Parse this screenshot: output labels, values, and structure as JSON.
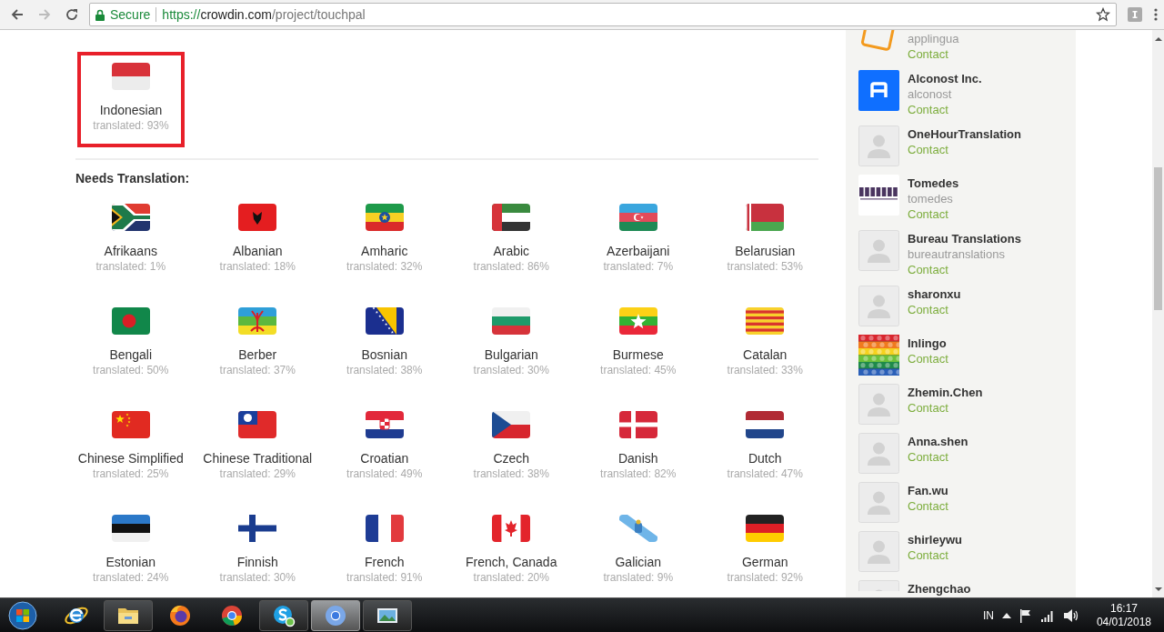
{
  "browser": {
    "secure_label": "Secure",
    "url": {
      "scheme": "https://",
      "host": "crowdin.com",
      "path": "/project/touchpal"
    }
  },
  "preferred": [
    {
      "name": "Indonesian",
      "progress": "translated: 93%",
      "selected": true
    }
  ],
  "needs_translation": {
    "title": "Needs Translation:",
    "languages": [
      {
        "name": "Afrikaans",
        "progress": "translated: 1%"
      },
      {
        "name": "Albanian",
        "progress": "translated: 18%"
      },
      {
        "name": "Amharic",
        "progress": "translated: 32%"
      },
      {
        "name": "Arabic",
        "progress": "translated: 86%"
      },
      {
        "name": "Azerbaijani",
        "progress": "translated: 7%"
      },
      {
        "name": "Belarusian",
        "progress": "translated: 53%"
      },
      {
        "name": "Bengali",
        "progress": "translated: 50%"
      },
      {
        "name": "Berber",
        "progress": "translated: 37%"
      },
      {
        "name": "Bosnian",
        "progress": "translated: 38%"
      },
      {
        "name": "Bulgarian",
        "progress": "translated: 30%"
      },
      {
        "name": "Burmese",
        "progress": "translated: 45%"
      },
      {
        "name": "Catalan",
        "progress": "translated: 33%"
      },
      {
        "name": "Chinese Simplified",
        "progress": "translated: 25%"
      },
      {
        "name": "Chinese Traditional",
        "progress": "translated: 29%"
      },
      {
        "name": "Croatian",
        "progress": "translated: 49%"
      },
      {
        "name": "Czech",
        "progress": "translated: 38%"
      },
      {
        "name": "Danish",
        "progress": "translated: 82%"
      },
      {
        "name": "Dutch",
        "progress": "translated: 47%"
      },
      {
        "name": "Estonian",
        "progress": "translated: 24%"
      },
      {
        "name": "Finnish",
        "progress": "translated: 30%"
      },
      {
        "name": "French",
        "progress": "translated: 91%"
      },
      {
        "name": "French, Canada",
        "progress": "translated: 20%"
      },
      {
        "name": "Galician",
        "progress": "translated: 9%"
      },
      {
        "name": "German",
        "progress": "translated: 92%"
      }
    ]
  },
  "vendors": [
    {
      "kind": "orange-logo",
      "handle": "applingua",
      "contact": "Contact"
    },
    {
      "kind": "blue-logo",
      "name": "Alconost Inc.",
      "handle": "alconost",
      "contact": "Contact"
    },
    {
      "kind": "placeholder",
      "name": "OneHourTranslation",
      "contact": "Contact"
    },
    {
      "kind": "wordmark-logo",
      "name": "Tomedes",
      "handle": "tomedes",
      "contact": "Contact"
    },
    {
      "kind": "placeholder",
      "name": "Bureau Translations",
      "handle": "bureautranslations",
      "contact": "Contact"
    },
    {
      "kind": "placeholder",
      "name": "sharonxu",
      "contact": "Contact"
    },
    {
      "kind": "picture",
      "name": "Inlingo",
      "contact": "Contact"
    },
    {
      "kind": "placeholder",
      "name": "Zhemin.Chen",
      "contact": "Contact"
    },
    {
      "kind": "placeholder",
      "name": "Anna.shen",
      "contact": "Contact"
    },
    {
      "kind": "placeholder",
      "name": "Fan.wu",
      "contact": "Contact"
    },
    {
      "kind": "placeholder",
      "name": "shirleywu",
      "contact": "Contact"
    },
    {
      "kind": "placeholder",
      "name": "Zhengchao"
    }
  ],
  "taskbar": {
    "apps": [
      {
        "kind": "ie",
        "open": false,
        "active": false
      },
      {
        "kind": "explorer",
        "open": true,
        "active": false
      },
      {
        "kind": "firefox",
        "open": false,
        "active": false
      },
      {
        "kind": "chrome",
        "open": false,
        "active": false
      },
      {
        "kind": "skype",
        "open": true,
        "active": false
      },
      {
        "kind": "chromium",
        "open": true,
        "active": true
      },
      {
        "kind": "photos",
        "open": true,
        "active": false
      }
    ],
    "tray": {
      "language": "IN",
      "time": "16:17",
      "date": "04/01/2018"
    }
  }
}
